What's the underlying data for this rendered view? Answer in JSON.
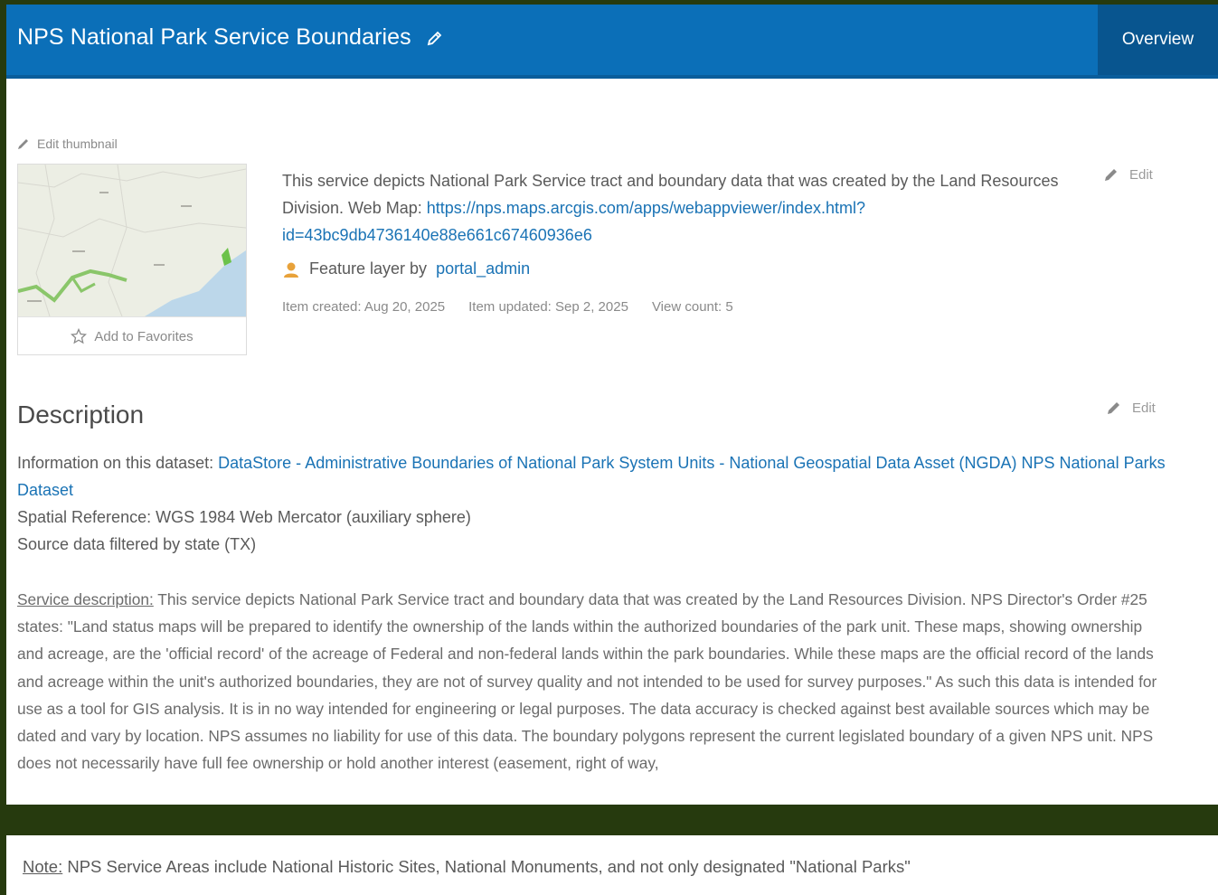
{
  "header": {
    "title": "NPS National Park Service Boundaries",
    "tab_overview": "Overview",
    "accent_color": "#0b6fb8"
  },
  "thumbnail": {
    "edit_label": "Edit thumbnail",
    "favorites_label": "Add to Favorites"
  },
  "summary": {
    "text": "This service depicts National Park Service tract and boundary data that was created by the Land Resources Division. Web Map: ",
    "url": "https://nps.maps.arcgis.com/apps/webappviewer/index.html?id=43bc9db4736140e88e661c67460936e6",
    "edit_label": "Edit"
  },
  "owner": {
    "prefix": "Feature layer by",
    "name": "portal_admin"
  },
  "meta": {
    "created": "Item created: Aug 20, 2025",
    "updated": "Item updated: Sep 2, 2025",
    "views": "View count: 5"
  },
  "description": {
    "heading": "Description",
    "edit_label": "Edit",
    "info_prefix": "Information on this dataset: ",
    "dataset_link": "DataStore - Administrative Boundaries of National Park System Units - National Geospatial Data Asset (NGDA) NPS National Parks Dataset",
    "spatial_ref": "Spatial Reference: WGS 1984 Web Mercator (auxiliary sphere)",
    "filter": "Source data filtered by state (TX)",
    "service_label": "Service description:",
    "service_text": " This service depicts National Park Service tract and boundary data that was created by the Land Resources Division. NPS Director's Order #25 states: \"Land status maps will be prepared to identify the ownership of the lands within the authorized boundaries of the park unit. These maps, showing ownership and acreage, are the 'official record' of the acreage of Federal and non-federal lands within the park boundaries. While these maps are the official record of the lands and acreage within the unit's authorized boundaries, they are not of survey quality and not intended to be used for survey purposes.\" As such this data is intended for use as a tool for GIS analysis. It is in no way intended for engineering or legal purposes. The data accuracy is checked against best available sources which may be dated and vary by location. NPS assumes no liability for use of this data. The boundary polygons represent the current legislated boundary of a given NPS unit. NPS does not necessarily have full fee ownership or hold another interest (easement, right of way,"
  },
  "note": {
    "label": "Note:",
    "text": " NPS Service Areas include National Historic Sites, National Monuments, and not only designated \"National Parks\""
  }
}
